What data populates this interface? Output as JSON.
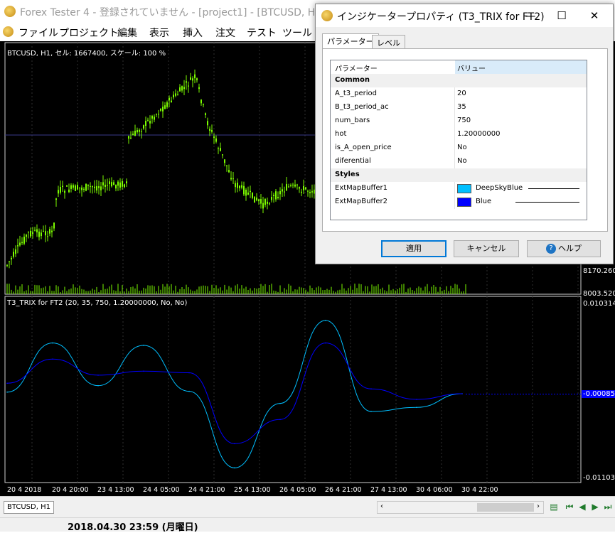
{
  "window": {
    "title": "Forex Tester 4 - 登録されていません - [project1] - [BTCUSD, H1]"
  },
  "menu": {
    "items": [
      "ファイル",
      "プロジェクト",
      "編集",
      "表示",
      "挿入",
      "注文",
      "テスト",
      "ツール"
    ]
  },
  "chart": {
    "header": "BTCUSD, H1, セル: 1667400, スケール: 100 %",
    "price_labels": [
      "8170.260",
      "8003.520"
    ],
    "indicator_header": "T3_TRIX for FT2 (20, 35, 750, 1.20000000, No, No)",
    "indicator_labels": {
      "top": "0.010314",
      "current": "-0.00085",
      "bottom": "-0.01103"
    },
    "dates": [
      "20 4 2018",
      "20 4 20:00",
      "23 4 13:00",
      "24 4 05:00",
      "24 4 21:00",
      "25 4 13:00",
      "26 4 05:00",
      "26 4 21:00",
      "27 4 13:00",
      "30 4 06:00",
      "30 4 22:00"
    ],
    "colors": {
      "candle": "#7cfc00",
      "line1": "#00bfff",
      "line2": "#0000ff",
      "grid": "#2f2f2f"
    }
  },
  "chart_data": [
    {
      "type": "line",
      "title": "T3_TRIX for FT2 (20, 35, 750, 1.20000000, No, No)",
      "xlabel": "",
      "ylabel": "",
      "x": [
        "20 4 2018",
        "20 4 20:00",
        "23 4 13:00",
        "24 4 05:00",
        "24 4 21:00",
        "25 4 13:00",
        "26 4 05:00",
        "26 4 21:00",
        "27 4 13:00",
        "30 4 06:00",
        "30 4 22:00"
      ],
      "series": [
        {
          "name": "ExtMapBuffer1",
          "values": [
            -0.0006,
            0.0055,
            0.0002,
            0.0052,
            -0.0005,
            -0.01,
            -0.002,
            0.0083,
            -0.003,
            -0.0025,
            -0.0008
          ]
        },
        {
          "name": "ExtMapBuffer2",
          "values": [
            0.0005,
            0.0035,
            0.0015,
            0.002,
            0.0018,
            -0.007,
            -0.004,
            0.0055,
            -0.0002,
            -0.0015,
            -0.0008
          ]
        }
      ],
      "ylim": [
        -0.01103,
        0.010314
      ]
    }
  ],
  "status": {
    "tab": "BTCUSD, H1",
    "datetime": "2018.04.30 23:59 (月曜日)"
  },
  "dialog": {
    "title": "インジケータープロパティ (T3_TRIX for FT2)",
    "tabs": [
      "パラメーター",
      "レベル"
    ],
    "grid_header": {
      "name": "パラメーター",
      "value": "バリュー"
    },
    "sections": {
      "common": "Common",
      "styles": "Styles"
    },
    "params": [
      {
        "name": "A_t3_period",
        "value": "20"
      },
      {
        "name": "B_t3_period_ac",
        "value": "35"
      },
      {
        "name": "num_bars",
        "value": "750"
      },
      {
        "name": "hot",
        "value": "1.20000000"
      },
      {
        "name": "is_A_open_price",
        "value": "No"
      },
      {
        "name": "diferential",
        "value": "No"
      }
    ],
    "styles": [
      {
        "name": "ExtMapBuffer1",
        "color_name": "DeepSkyBlue",
        "color": "#00bfff"
      },
      {
        "name": "ExtMapBuffer2",
        "color_name": "Blue",
        "color": "#0000ff"
      }
    ],
    "buttons": {
      "apply": "適用",
      "cancel": "キャンセル",
      "help": "ヘルプ"
    }
  }
}
